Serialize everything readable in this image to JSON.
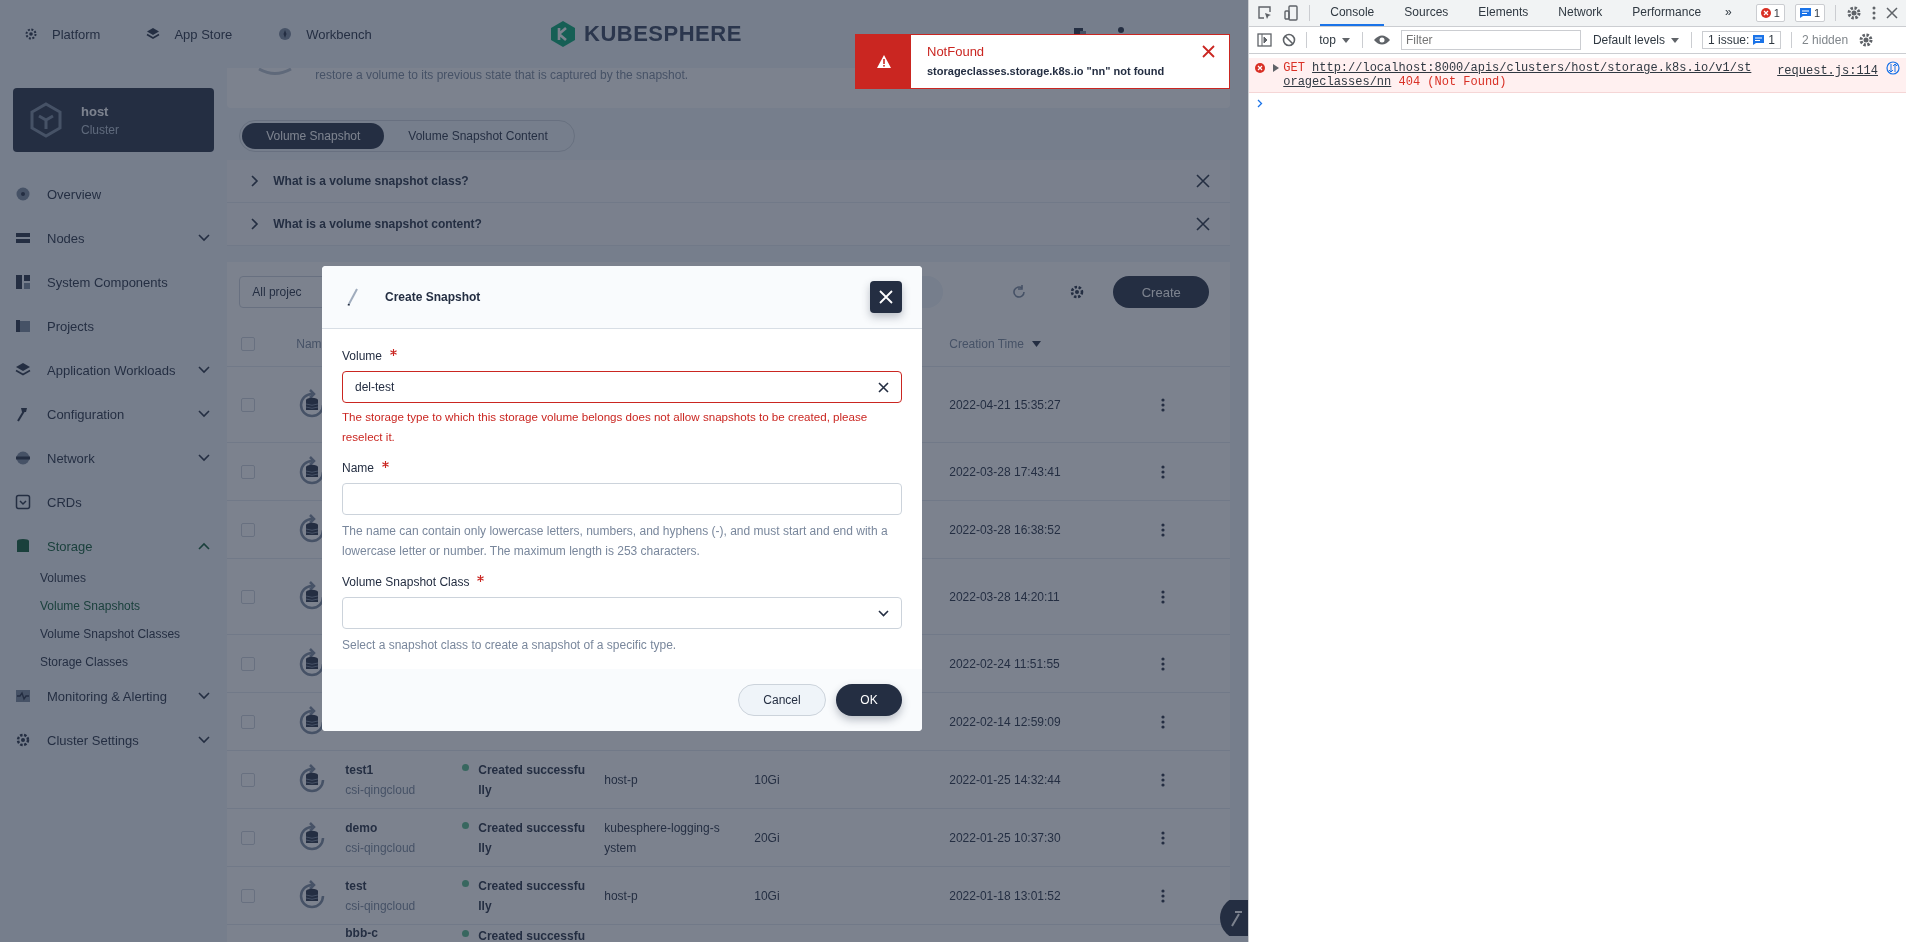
{
  "header": {
    "nav": [
      {
        "label": "Platform"
      },
      {
        "label": "App Store"
      },
      {
        "label": "Workbench"
      }
    ],
    "logo": "KUBESPHERE"
  },
  "toast": {
    "title": "NotFound",
    "message": "storageclasses.storage.k8s.io \"nn\" not found"
  },
  "sidebar": {
    "cluster": {
      "name": "host",
      "type": "Cluster"
    },
    "items": [
      {
        "label": "Overview",
        "selected": false
      },
      {
        "label": "Nodes",
        "selected": false,
        "expanded": false
      },
      {
        "label": "System Components",
        "selected": false
      },
      {
        "label": "Projects",
        "selected": false
      },
      {
        "label": "Application Workloads",
        "selected": false,
        "expanded": false
      },
      {
        "label": "Configuration",
        "selected": false,
        "expanded": false
      },
      {
        "label": "Network",
        "selected": false,
        "expanded": false
      },
      {
        "label": "CRDs",
        "selected": false
      },
      {
        "label": "Storage",
        "selected": true,
        "expanded": true,
        "children": [
          {
            "label": "Volumes",
            "selected": false
          },
          {
            "label": "Volume Snapshots",
            "selected": true
          },
          {
            "label": "Volume Snapshot Classes",
            "selected": false
          },
          {
            "label": "Storage Classes",
            "selected": false
          }
        ]
      },
      {
        "label": "Monitoring & Alerting",
        "selected": false,
        "expanded": false
      },
      {
        "label": "Cluster Settings",
        "selected": false,
        "expanded": false
      }
    ]
  },
  "banner": {
    "description": "restore a volume to its previous state that is captured by the snapshot."
  },
  "tabs": [
    {
      "label": "Volume Snapshot",
      "selected": true
    },
    {
      "label": "Volume Snapshot Content",
      "selected": false
    }
  ],
  "faq": [
    {
      "question": "What is a volume snapshot class?"
    },
    {
      "question": "What is a volume snapshot content?"
    }
  ],
  "toolbar": {
    "project_filter": "All projec",
    "create_button": "Create"
  },
  "table": {
    "select_all_checked": false,
    "columns": [
      {
        "heading": "Nam"
      },
      {
        "heading": "Creation Time",
        "sorted_descending": true
      }
    ],
    "rows": [
      {
        "checked": false,
        "created": "2022-04-21 15:35:27"
      },
      {
        "checked": false,
        "created": "2022-03-28 17:43:41"
      },
      {
        "checked": false,
        "created": "2022-03-28 16:38:52"
      },
      {
        "checked": false,
        "created": "2022-03-28 14:20:11"
      },
      {
        "checked": false,
        "created": "2022-02-24 11:51:55"
      },
      {
        "checked": false,
        "created": "2022-02-14 12:59:09"
      },
      {
        "checked": false,
        "name": "test1",
        "storage_class": "csi-qingcloud",
        "status": "Created successfully",
        "project": "host-p",
        "capacity": "10Gi",
        "created": "2022-01-25 14:32:44"
      },
      {
        "checked": false,
        "name": "demo",
        "storage_class": "csi-qingcloud",
        "status": "Created successfully",
        "project": "kubesphere-logging-system",
        "capacity": "20Gi",
        "created": "2022-01-25 10:37:30"
      },
      {
        "checked": false,
        "name": "test",
        "storage_class": "csi-qingcloud",
        "status": "Created successfully",
        "project": "host-p",
        "capacity": "10Gi",
        "created": "2022-01-18 13:01:52"
      },
      {
        "name": "bbb-c",
        "status": "Created successfu"
      }
    ]
  },
  "modal": {
    "title": "Create Snapshot",
    "fields": [
      {
        "kind": "select",
        "label": "Volume",
        "required": true,
        "value": "del-test",
        "clearable": true,
        "error": "The storage type to which this storage volume belongs does not allow snapshots to be created, please reselect it."
      },
      {
        "kind": "text",
        "label": "Name",
        "required": true,
        "hint": "The name can contain only lowercase letters, numbers, and hyphens (-), and must start and end with a lowercase letter or number. The maximum length is 253 characters."
      },
      {
        "kind": "select",
        "label": "Volume Snapshot Class",
        "required": true,
        "clearable": false,
        "hint": "Select a snapshot class to create a snapshot of a specific type."
      }
    ],
    "cancel": "Cancel",
    "ok": "OK"
  },
  "devtools": {
    "tabs": [
      {
        "label": "Console",
        "selected": true
      },
      {
        "label": "Sources",
        "selected": false
      },
      {
        "label": "Elements",
        "selected": false
      },
      {
        "label": "Network",
        "selected": false
      },
      {
        "label": "Performance",
        "selected": false
      }
    ],
    "overflow": "»",
    "error_count": "1",
    "message_count": "1",
    "console_toolbar": {
      "context": "top",
      "filter_placeholder": "Filter",
      "levels": "Default levels",
      "issues_label": "1 issue:",
      "issues_count": "1",
      "hidden": "2 hidden"
    },
    "log": [
      {
        "method": "GET",
        "url": "http://localhost:8000/apis/clusters/host/storage.k8s.io/v1/storageclasses/nn",
        "status": "404 (Not Found)",
        "source": "request.js:114"
      }
    ]
  }
}
